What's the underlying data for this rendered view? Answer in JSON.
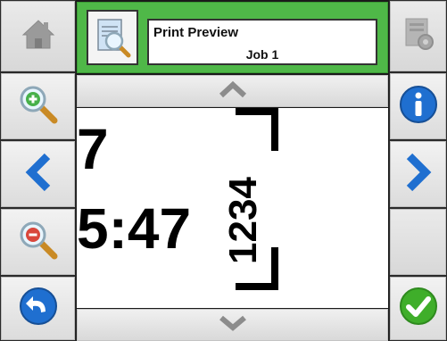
{
  "header": {
    "title": "Print Preview",
    "job": "Job 1"
  },
  "preview": {
    "line_number": "7",
    "time": "5:47",
    "rotated_text": "1234"
  },
  "left_buttons": [
    "home",
    "zoom-in",
    "previous",
    "zoom-out",
    "back"
  ],
  "right_buttons": [
    "print-settings",
    "info",
    "next",
    "blank",
    "confirm"
  ],
  "colors": {
    "header_green": "#4fb848",
    "blue_button": "#1f6fd0",
    "green_button": "#3fae2a"
  }
}
